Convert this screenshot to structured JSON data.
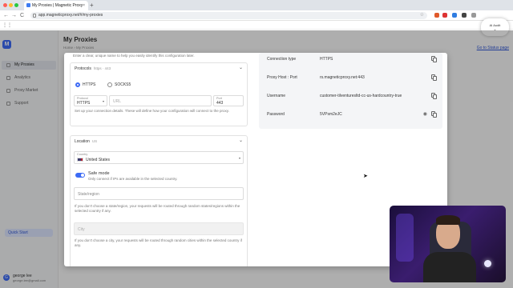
{
  "browser": {
    "tab_title": "My Proxies | Magnetic Proxy",
    "tab_close": "×",
    "new_tab": "+",
    "url": "app.magneticproxy.net/#/my-proxies",
    "nav_back": "←",
    "nav_forward": "→",
    "nav_reload": "C",
    "bookmark_star": "☆",
    "ai_pill_label": "AI Audit",
    "ai_pill_chevron": "⌄"
  },
  "sidebar": {
    "logo": "M",
    "items": [
      {
        "label": "My Proxies",
        "active": true
      },
      {
        "label": "Analytics"
      },
      {
        "label": "Proxy Market"
      },
      {
        "label": "Support"
      }
    ],
    "upgrade_label": "Quick Start",
    "user_initial": "G",
    "user_name": "george lee",
    "user_email": "george.lee@gmail.com"
  },
  "page": {
    "title": "My Proxies",
    "breadcrumb": "Home  ›  My Proxies",
    "status_link": "Go to Status page"
  },
  "modal": {
    "top_hint": "Enter a clear, unique name to help you easily identify this configuration later.",
    "protocols": {
      "title": "Protocols",
      "subtitle": "https · 443",
      "chevron": "⌄",
      "options": [
        "HTTPS",
        "SOCKS5"
      ],
      "selected": "HTTPS",
      "protocol_label": "Protocol",
      "protocol_value": "HTTPS",
      "url_placeholder": "URL",
      "port_label": "Port",
      "port_value": "443",
      "hint": "Set up your connection details. These will define how your configuration will connect to the proxy."
    },
    "location": {
      "title": "Location",
      "subtitle": "US",
      "chevron": "⌄",
      "country_label": "Country",
      "country_value": "United States",
      "caret": "▾",
      "safe_mode_label": "Safe mode",
      "safe_mode_on": true,
      "safe_mode_hint": "Only connect if IPs are available in the selected country.",
      "state_placeholder": "State/region",
      "state_hint": "If you don't choose a state/region, your requests will be routed through random states/regions within the selected country if any.",
      "city_placeholder": "City",
      "city_hint": "If you don't choose a city, your requests will be routed through random cities within the selected country if any."
    },
    "details": [
      {
        "key": "Connection type",
        "value": "HTTPS"
      },
      {
        "key": "Proxy Host : Port",
        "value": "rs.magneticproxy.net:443"
      },
      {
        "key": "Username",
        "value": "customer-tilventuresltd-cc-us-hardcountry-true"
      },
      {
        "key": "Password",
        "value": "5VPsm2eJC"
      }
    ],
    "password_eye": "◉"
  },
  "cursor": "➤",
  "colors": {
    "accent": "#3d6bf5",
    "link": "#3057d6"
  }
}
